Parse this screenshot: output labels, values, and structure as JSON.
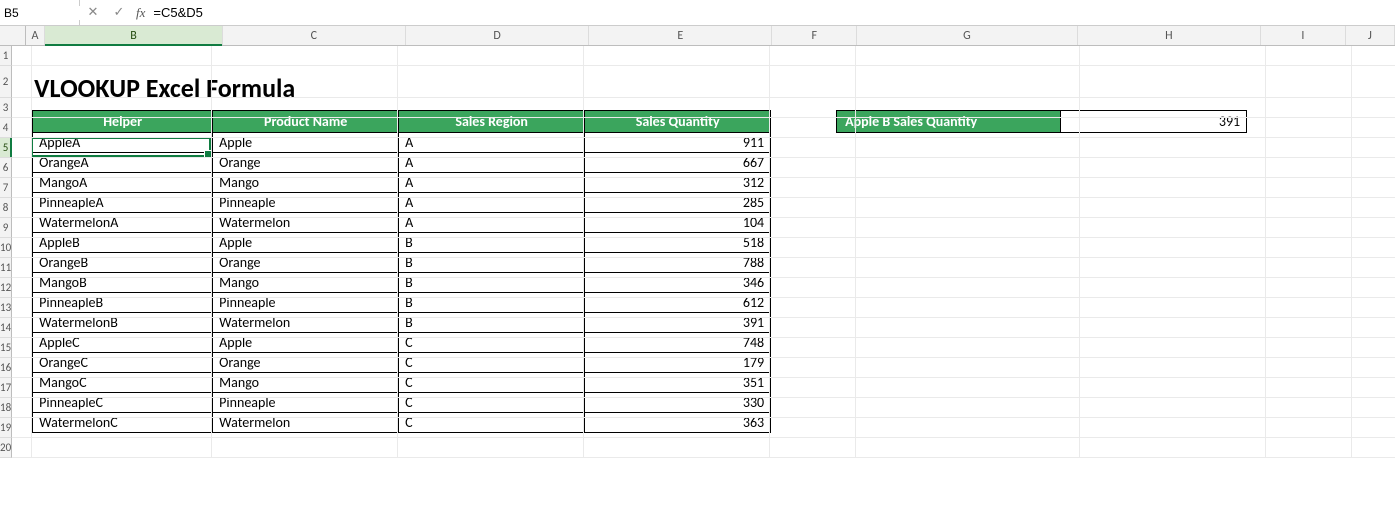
{
  "formula_bar": {
    "name_box": "B5",
    "fx_label": "fx",
    "formula": "=C5&D5",
    "cancel_glyph": "✕",
    "confirm_glyph": "✓"
  },
  "columns": [
    "A",
    "B",
    "C",
    "D",
    "E",
    "F",
    "G",
    "H",
    "I",
    "J"
  ],
  "selected_col": "B",
  "selected_row": 5,
  "rows_visible": 20,
  "title": "VLOOKUP Excel Formula",
  "table": {
    "headers": [
      "Helper",
      "Product Name",
      "Sales Region",
      "Sales Quantity"
    ],
    "rows": [
      {
        "helper": "AppleA",
        "product": "Apple",
        "region": "A",
        "qty": 911
      },
      {
        "helper": "OrangeA",
        "product": "Orange",
        "region": "A",
        "qty": 667
      },
      {
        "helper": "MangoA",
        "product": "Mango",
        "region": "A",
        "qty": 312
      },
      {
        "helper": "PinneapleA",
        "product": "Pinneaple",
        "region": "A",
        "qty": 285
      },
      {
        "helper": "WatermelonA",
        "product": "Watermelon",
        "region": "A",
        "qty": 104
      },
      {
        "helper": "AppleB",
        "product": "Apple",
        "region": "B",
        "qty": 518
      },
      {
        "helper": "OrangeB",
        "product": "Orange",
        "region": "B",
        "qty": 788
      },
      {
        "helper": "MangoB",
        "product": "Mango",
        "region": "B",
        "qty": 346
      },
      {
        "helper": "PinneapleB",
        "product": "Pinneaple",
        "region": "B",
        "qty": 612
      },
      {
        "helper": "WatermelonB",
        "product": "Watermelon",
        "region": "B",
        "qty": 391
      },
      {
        "helper": "AppleC",
        "product": "Apple",
        "region": "C",
        "qty": 748
      },
      {
        "helper": "OrangeC",
        "product": "Orange",
        "region": "C",
        "qty": 179
      },
      {
        "helper": "MangoC",
        "product": "Mango",
        "region": "C",
        "qty": 351
      },
      {
        "helper": "PinneapleC",
        "product": "Pinneaple",
        "region": "C",
        "qty": 330
      },
      {
        "helper": "WatermelonC",
        "product": "Watermelon",
        "region": "C",
        "qty": 363
      }
    ]
  },
  "side": {
    "label": "Apple B Sales Quantity",
    "value": 391
  },
  "colors": {
    "header_bg": "#3ba55d",
    "accent": "#107c41"
  }
}
